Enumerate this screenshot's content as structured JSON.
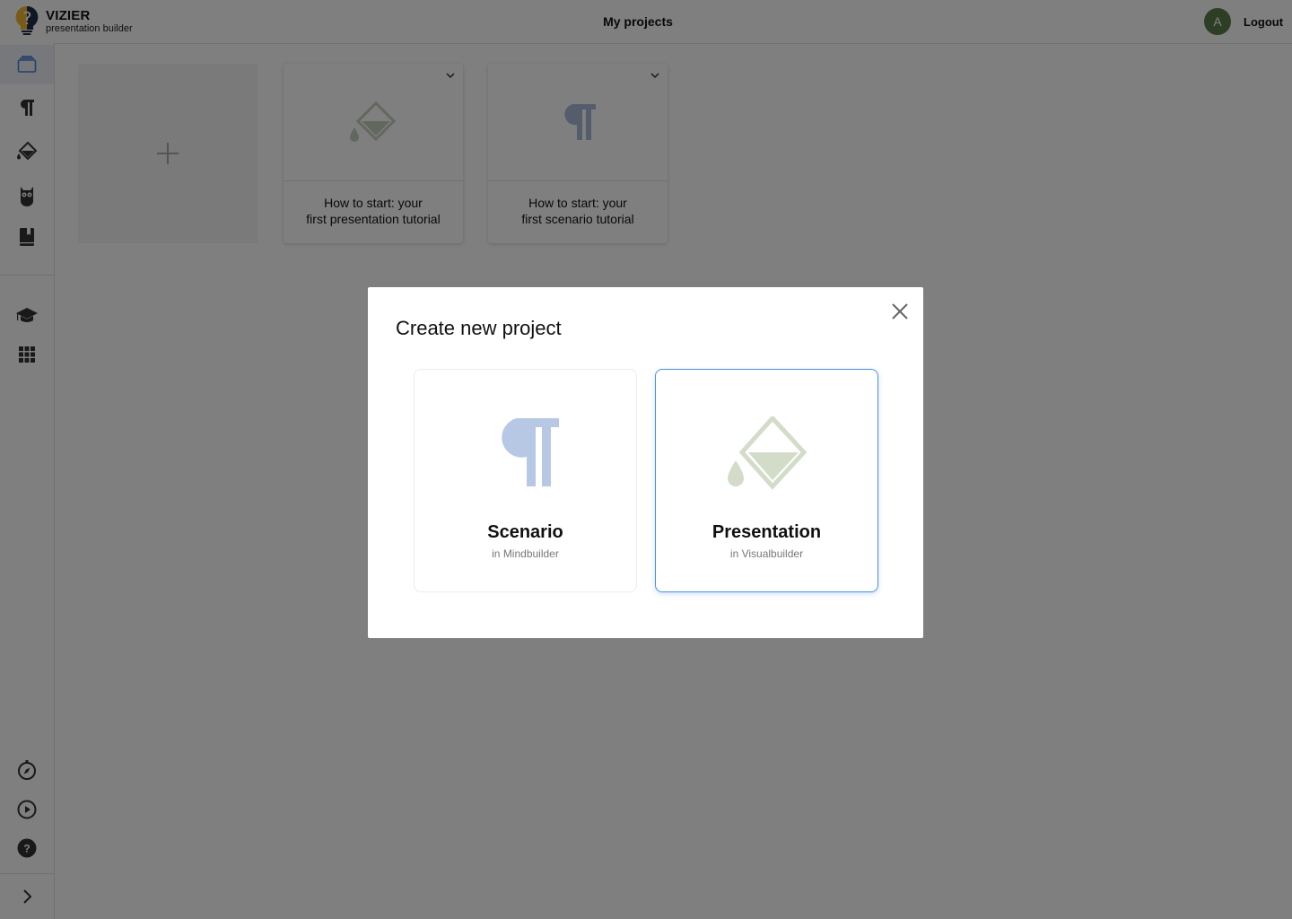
{
  "header": {
    "brand_name": "VIZIER",
    "brand_sub": "presentation builder",
    "page_title": "My projects",
    "avatar_initial": "A",
    "logout_label": "Logout"
  },
  "sidebar": {
    "top_items": [
      "projects-icon",
      "paragraph-icon",
      "paint-bucket-icon",
      "owl-icon",
      "book-icon"
    ],
    "middle_items": [
      "graduation-cap-icon",
      "grid-icon"
    ],
    "bottom_items": [
      "compass-icon",
      "play-icon",
      "help-icon",
      "chevron-right-icon"
    ],
    "active_item": "projects-icon"
  },
  "projects": {
    "new_card_icon": "plus-icon",
    "cards": [
      {
        "label_line1": "How to start: your",
        "label_line2": "first presentation tutorial",
        "icon": "paint-bucket-icon"
      },
      {
        "label_line1": "How to start: your",
        "label_line2": "first scenario tutorial",
        "icon": "paragraph-icon"
      }
    ]
  },
  "modal": {
    "title": "Create new project",
    "options": [
      {
        "title": "Scenario",
        "subtitle": "in Mindbuilder",
        "icon": "paragraph-icon",
        "selected": false
      },
      {
        "title": "Presentation",
        "subtitle": "in Visualbuilder",
        "icon": "paint-bucket-icon",
        "selected": true
      }
    ]
  },
  "colors": {
    "scenario_accent": "#b7c8e5",
    "presentation_accent": "#d3dbc9",
    "selected_border": "#4a90e2",
    "avatar_bg": "#5a7d4a",
    "logo_yellow": "#f2b632",
    "logo_navy": "#1f2d4d"
  }
}
